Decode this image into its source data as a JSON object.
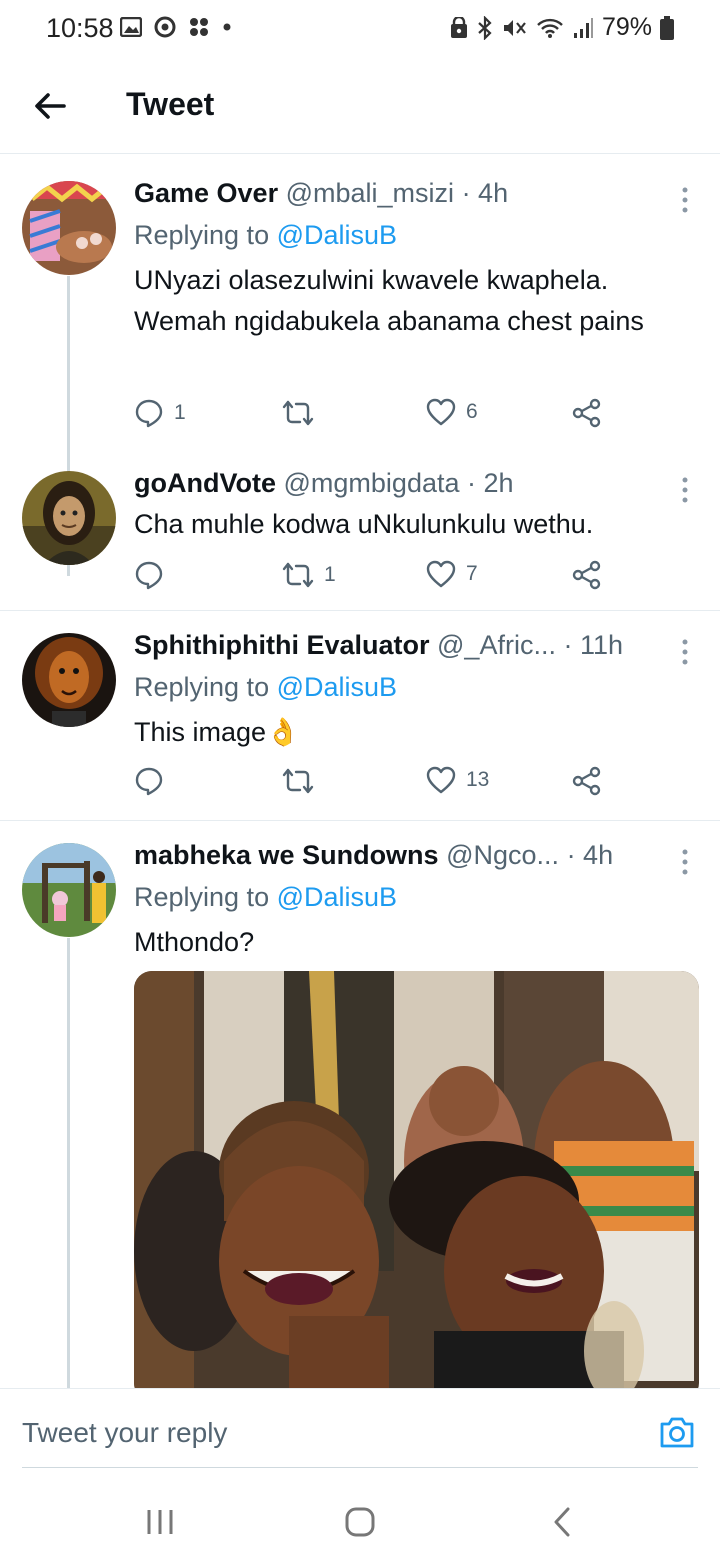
{
  "status_bar": {
    "time": "10:58",
    "battery": "79%",
    "left_icons": [
      "gallery-icon",
      "chrome-icon",
      "fan-icon",
      "dot-icon"
    ],
    "right_icons": [
      "lock-icon",
      "bluetooth-icon",
      "mute-icon",
      "wifi-icon",
      "signal-icon",
      "battery-icon"
    ]
  },
  "header": {
    "title": "Tweet",
    "back_icon": "arrow-left-icon"
  },
  "tweets": [
    {
      "name": "Game Over",
      "handle": "@mbali_msizi",
      "time": "· 4h",
      "replying_label": "Replying to",
      "replying_handle": "@DalisuB",
      "text": "UNyazi olasezulwini kwavele kwaphela. Wemah ngidabukela abanama chest pains",
      "replies": "1",
      "retweets": "",
      "likes": "6"
    },
    {
      "name": "goAndVote",
      "handle": "@mgmbigdata",
      "time": "· 2h",
      "text": "Cha muhle kodwa uNkulunkulu wethu.",
      "replies": "",
      "retweets": "1",
      "likes": "7"
    },
    {
      "name": "Sphithiphithi Evaluator",
      "handle": "@_Afric...",
      "time": "· 11h",
      "replying_label": "Replying to",
      "replying_handle": "@DalisuB",
      "text": "This image",
      "emoji": "👌",
      "replies": "",
      "retweets": "",
      "likes": "13"
    },
    {
      "name": "mabheka we Sundowns",
      "handle": "@Ngco...",
      "time": "· 4h",
      "replying_label": "Replying to",
      "replying_handle": "@DalisuB",
      "text": "Mthondo?"
    }
  ],
  "reply_bar": {
    "placeholder": "Tweet your reply",
    "camera_icon": "camera-icon"
  },
  "nav_bar": {
    "icons": [
      "recent-apps-icon",
      "home-icon",
      "back-icon"
    ]
  },
  "colors": {
    "link": "#1d9bf0",
    "secondary_text": "#536471",
    "divider": "#e6ecf0"
  }
}
